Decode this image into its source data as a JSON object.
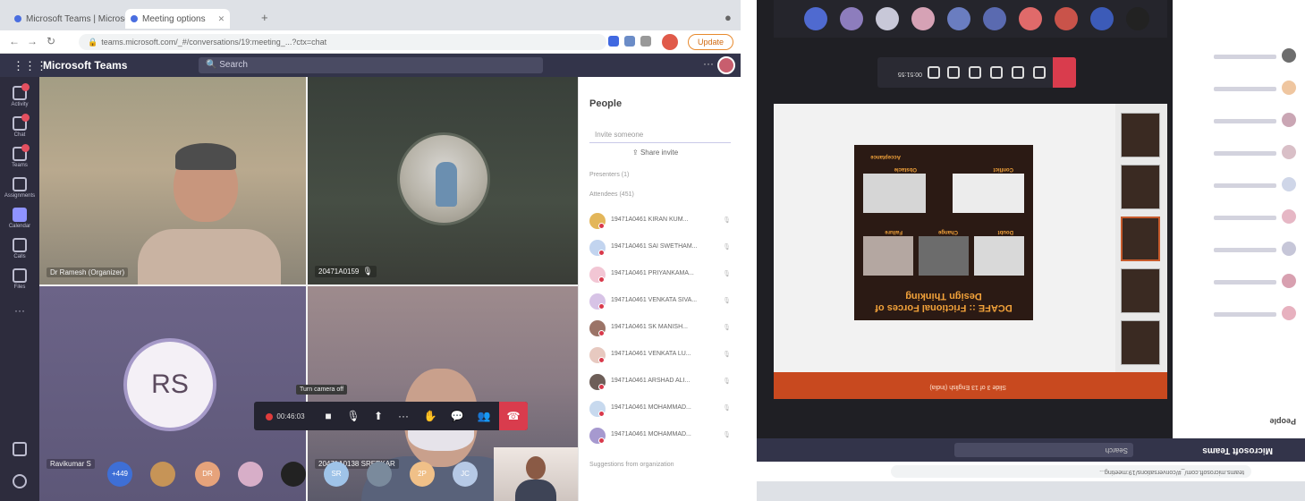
{
  "left": {
    "browser": {
      "tabs": [
        {
          "label": "Microsoft Teams | Microsoft Teams"
        },
        {
          "label": "Meeting options"
        }
      ],
      "url": "teams.microsoft.com/_#/conversations/19:meeting_...?ctx=chat",
      "update_label": "Update"
    },
    "teams": {
      "title": "Microsoft Teams",
      "search_placeholder": "Search"
    },
    "rail": [
      {
        "label": "Activity",
        "badge": true
      },
      {
        "label": "Chat",
        "badge": true
      },
      {
        "label": "Teams",
        "badge": true
      },
      {
        "label": "Assignments",
        "badge": false
      },
      {
        "label": "Calendar",
        "badge": false,
        "selected": true
      },
      {
        "label": "Calls",
        "badge": false
      },
      {
        "label": "Files",
        "badge": false
      }
    ],
    "tiles": {
      "tile1_name": "Dr Ramesh (Organizer)",
      "tile2_name": "20471A0159",
      "tile3_initials": "RS",
      "tile3_name": "Ravikumar S",
      "tile4_name": "20471A0138 SREEKAR"
    },
    "controls": {
      "timer": "00:46:03",
      "tooltip": "Turn camera off"
    },
    "strip": [
      {
        "label": "+449",
        "color": "#3e6fd6"
      },
      {
        "label": "",
        "color": "#c69457"
      },
      {
        "label": "DR",
        "color": "#e6a37b"
      },
      {
        "label": "",
        "color": "#d7aec8"
      },
      {
        "label": "",
        "color": "#222222"
      },
      {
        "label": "SR",
        "color": "#9fc3e8"
      },
      {
        "label": "",
        "color": "#7a8a9c"
      },
      {
        "label": "2P",
        "color": "#f0c088"
      },
      {
        "label": "JC",
        "color": "#b6c9e6"
      }
    ],
    "people": {
      "title": "People",
      "invite_placeholder": "Invite someone",
      "share_label": "Share invite",
      "presenters_label": "Presenters (1)",
      "attendees_label": "Attendees (451)",
      "rows": [
        {
          "name": "19471A0461 KIRAN KUM...",
          "color": "#e3b65a"
        },
        {
          "name": "19471A0461 SAI SWETHAM...",
          "color": "#c2d4ef"
        },
        {
          "name": "19471A0461 PRIYANKAMA...",
          "color": "#f2c6d4"
        },
        {
          "name": "19471A0461 VENKATA SIVA...",
          "color": "#d7c3e6"
        },
        {
          "name": "19471A0461 SK MANISH...",
          "color": "#9b7467"
        },
        {
          "name": "19471A0461 VENKATA LU...",
          "color": "#e7c9c0"
        },
        {
          "name": "19471A0461 ARSHAD ALI...",
          "color": "#6d5e58"
        },
        {
          "name": "19471A0461 MOHAMMAD...",
          "color": "#c7d9ee"
        },
        {
          "name": "19471A0461 MOHAMMAD...",
          "color": "#a699cf"
        }
      ],
      "footer": "Suggestions from organization"
    }
  },
  "right": {
    "url": "teams.microsoft.com/_#/conversations/19:meeting...",
    "teams_title": "Microsoft Teams",
    "search_placeholder": "Search",
    "people_title": "People",
    "slide": {
      "title": "DCAFE :: Frictional Forces of Design Thinking",
      "labels": [
        "Doubt",
        "Change",
        "Failure",
        "Conflict",
        "Obstacle",
        "Acceptance"
      ]
    },
    "timer": "00:51:55",
    "ribbon_text": "Slide 3 of 13  English (India)"
  }
}
